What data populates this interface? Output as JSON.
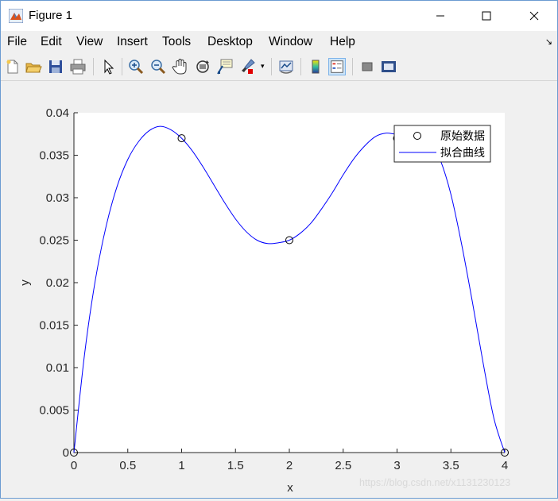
{
  "window": {
    "title": "Figure 1"
  },
  "menu": [
    "File",
    "Edit",
    "View",
    "Insert",
    "Tools",
    "Desktop",
    "Window",
    "Help"
  ],
  "toolbar": [
    "new-figure-icon",
    "open-file-icon",
    "save-icon",
    "print-icon",
    "pointer-icon",
    "zoom-in-icon",
    "zoom-out-icon",
    "pan-hand-icon",
    "rotate-3d-icon",
    "data-cursor-icon",
    "brush-icon",
    "link-plot-icon",
    "colorbar-icon",
    "legend-icon",
    "hide-plot-tools-icon",
    "show-plot-tools-icon"
  ],
  "chart_data": {
    "type": "line",
    "xlabel": "x",
    "ylabel": "y",
    "xlim": [
      0,
      4
    ],
    "ylim": [
      0,
      0.04
    ],
    "xticks": [
      0,
      0.5,
      1,
      1.5,
      2,
      2.5,
      3,
      3.5,
      4
    ],
    "xtick_labels": [
      "0",
      "0.5",
      "1",
      "1.5",
      "2",
      "2.5",
      "3",
      "3.5",
      "4"
    ],
    "yticks": [
      0,
      0.005,
      0.01,
      0.015,
      0.02,
      0.025,
      0.03,
      0.035,
      0.04
    ],
    "ytick_labels": [
      "0",
      "0.005",
      "0.01",
      "0.015",
      "0.02",
      "0.025",
      "0.03",
      "0.035",
      "0.04"
    ],
    "grid": false,
    "legend_position": "top-right",
    "series": [
      {
        "name": "原始数据",
        "style": "markers-circle",
        "color": "#000000",
        "x": [
          0,
          1,
          2,
          3,
          4
        ],
        "y": [
          0,
          0.037,
          0.025,
          0.037,
          0
        ]
      },
      {
        "name": "拟合曲线",
        "style": "line",
        "color": "#0000ff",
        "x": [
          0,
          0.1,
          0.2,
          0.3,
          0.4,
          0.5,
          0.6,
          0.7,
          0.8,
          0.9,
          1.0,
          1.1,
          1.2,
          1.3,
          1.4,
          1.5,
          1.6,
          1.7,
          1.8,
          1.9,
          2.0,
          2.1,
          2.2,
          2.3,
          2.4,
          2.5,
          2.6,
          2.7,
          2.8,
          2.9,
          3.0,
          3.1,
          3.2,
          3.3,
          3.4,
          3.5,
          3.6,
          3.7,
          3.8,
          3.9,
          4.0
        ],
        "y": [
          0,
          0.0117,
          0.0204,
          0.0267,
          0.0313,
          0.0345,
          0.0366,
          0.0379,
          0.0384,
          0.038,
          0.037,
          0.0355,
          0.0336,
          0.0315,
          0.0294,
          0.0275,
          0.026,
          0.025,
          0.0246,
          0.0247,
          0.025,
          0.0258,
          0.027,
          0.0287,
          0.0306,
          0.0327,
          0.0346,
          0.0361,
          0.0372,
          0.0376,
          0.0375,
          0.0379,
          0.038,
          0.037,
          0.0345,
          0.0304,
          0.0245,
          0.0177,
          0.0105,
          0.004,
          0
        ]
      }
    ]
  },
  "watermark": "https://blog.csdn.net/x1131230123"
}
